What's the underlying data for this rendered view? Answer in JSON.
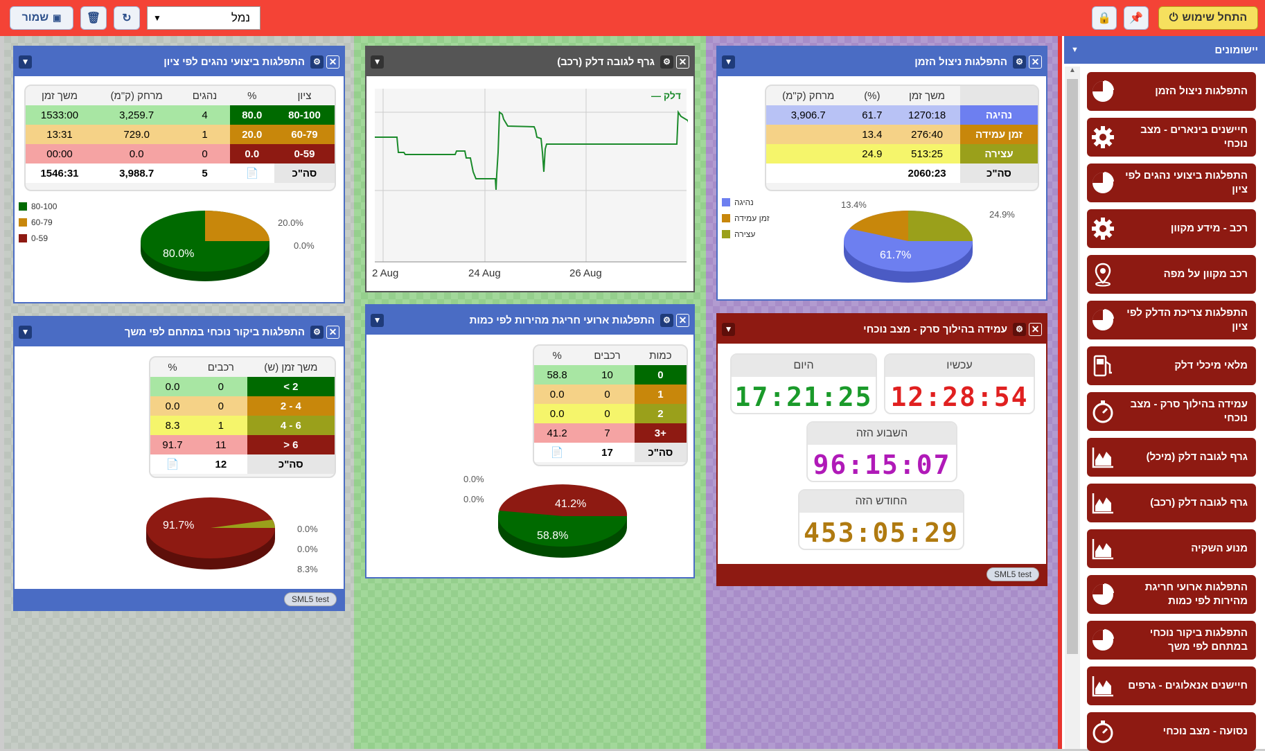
{
  "toolbar": {
    "start_label": "התחל שימוש",
    "save_label": "שמור",
    "profile_value": "נמל"
  },
  "apps": {
    "title": "יישומונים",
    "items": [
      {
        "label": "התפלגות ניצול הזמן",
        "icon": "pie-chart-icon"
      },
      {
        "label": "חיישנים בינארים - מצב נוכחי",
        "icon": "gear-icon"
      },
      {
        "label": "התפלגות ביצועי נהגים לפי ציון",
        "icon": "pie-chart-icon"
      },
      {
        "label": "רכב - מידע מקוון",
        "icon": "gear-icon"
      },
      {
        "label": "רכב מקוון על מפה",
        "icon": "map-pin-icon"
      },
      {
        "label": "התפלגות צריכת הדלק לפי ציון",
        "icon": "pie-chart-icon"
      },
      {
        "label": "מלאי מיכלי דלק",
        "icon": "fuel-pump-icon"
      },
      {
        "label": "עמידה בהילוך סרק - מצב נוכחי",
        "icon": "stopwatch-icon"
      },
      {
        "label": "גרף לגובה דלק (מיכל)",
        "icon": "area-chart-icon"
      },
      {
        "label": "גרף לגובה דלק (רכב)",
        "icon": "area-chart-icon"
      },
      {
        "label": "מנוע השקיה",
        "icon": "area-chart-icon"
      },
      {
        "label": "התפלגות ארועי חריגת מהירות לפי כמות",
        "icon": "pie-chart-icon"
      },
      {
        "label": "התפלגות ביקור נוכחי במתחם לפי משך",
        "icon": "pie-chart-icon"
      },
      {
        "label": "חיישנים אנאלוגים - גרפים",
        "icon": "area-chart-icon"
      },
      {
        "label": "נסועה - מצב נוכחי",
        "icon": "stopwatch-icon"
      }
    ]
  },
  "w_drivers": {
    "title": "התפלגות ביצועי נהגים לפי ציון",
    "headers": [
      "ציון",
      "%",
      "נהגים",
      "מרחק (ק\"מ)",
      "משך זמן"
    ],
    "rows": [
      [
        "80-100",
        "80.0",
        "4",
        "3,259.7",
        "1533:00"
      ],
      [
        "60-79",
        "20.0",
        "1",
        "729.0",
        "13:31"
      ],
      [
        "0-59",
        "0.0",
        "0",
        "0.0",
        "00:00"
      ]
    ],
    "total": [
      "סה\"כ",
      "",
      "5",
      "3,988.7",
      "1546:31"
    ],
    "legend": [
      "80-100",
      "60-79",
      "0-59"
    ],
    "pie_labels": {
      "main": "80.0%",
      "a": "20.0%",
      "b": "0.0%"
    }
  },
  "w_fuel": {
    "title": "גרף לגובה דלק (רכב)",
    "series": "דלק",
    "ticks": [
      "2 Aug",
      "24 Aug",
      "26 Aug"
    ]
  },
  "w_time": {
    "title": "התפלגות ניצול הזמן",
    "headers": [
      "",
      "משך זמן",
      "(%)",
      "מרחק (ק\"מ)"
    ],
    "rows": [
      [
        "נהיגה",
        "1270:18",
        "61.7",
        "3,906.7"
      ],
      [
        "זמן עמידה",
        "276:40",
        "13.4",
        ""
      ],
      [
        "עצירה",
        "513:25",
        "24.9",
        ""
      ]
    ],
    "total": [
      "סה\"כ",
      "2060:23",
      "",
      ""
    ],
    "legend": [
      "נהיגה",
      "זמן עמידה",
      "עצירה"
    ],
    "pie_labels": {
      "main": "61.7%",
      "a": "13.4%",
      "b": "24.9%"
    }
  },
  "w_visit": {
    "title": "התפלגות ביקור נוכחי במתחם לפי משך",
    "headers": [
      "משך זמן (ש)",
      "רכבים",
      "%"
    ],
    "rows": [
      [
        "2 >",
        "0",
        "0.0"
      ],
      [
        "4 - 2",
        "0",
        "0.0"
      ],
      [
        "6 - 4",
        "1",
        "8.3"
      ],
      [
        "6 <",
        "11",
        "91.7"
      ]
    ],
    "total": [
      "סה\"כ",
      "12",
      ""
    ],
    "pie_labels": {
      "main": "91.7%",
      "a": "0.0%",
      "b": "0.0%",
      "c": "8.3%"
    },
    "footer": "SML5 test"
  },
  "w_speed": {
    "title": "התפלגות ארועי חריגת מהירות לפי כמות",
    "headers": [
      "כמות",
      "רכבים",
      "%"
    ],
    "rows": [
      [
        "0",
        "10",
        "58.8"
      ],
      [
        "1",
        "0",
        "0.0"
      ],
      [
        "2",
        "0",
        "0.0"
      ],
      [
        "+3",
        "7",
        "41.2"
      ]
    ],
    "total": [
      "סה\"כ",
      "17",
      ""
    ],
    "pie_labels": {
      "main": "58.8%",
      "a": "41.2%",
      "b": "0.0%",
      "c": "0.0%"
    }
  },
  "w_idle": {
    "title": "עמידה בהילוך סרק - מצב נוכחי",
    "now_label": "עכשיו",
    "now_value": "12:28:54",
    "today_label": "היום",
    "today_value": "17:21:25",
    "week_label": "השבוע הזה",
    "week_value": "96:15:07",
    "month_label": "החודש הזה",
    "month_value": "453:05:29",
    "footer": "SML5 test"
  },
  "colors": {
    "green": "#006a00",
    "orange": "#c8870b",
    "darkred": "#8e1a12",
    "olive": "#9aa01b",
    "blue": "#6d7ff0"
  }
}
